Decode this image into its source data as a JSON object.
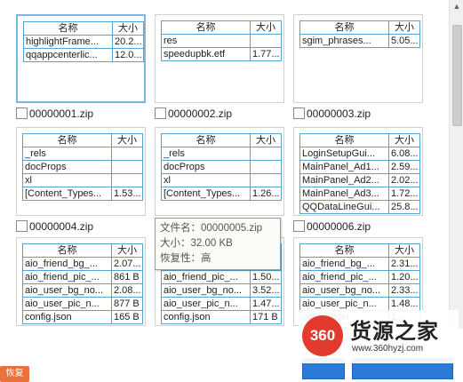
{
  "header": {
    "name": "名称",
    "size": "大小"
  },
  "items": [
    {
      "caption": "00000001.zip",
      "selected": true,
      "rows": [
        [
          "highlightFrame...",
          "20.2..."
        ],
        [
          "qqappcenterlic...",
          "12.0..."
        ]
      ]
    },
    {
      "caption": "00000002.zip",
      "selected": false,
      "rows": [
        [
          "res",
          ""
        ],
        [
          "speedupbk.etf",
          "1.77..."
        ]
      ]
    },
    {
      "caption": "00000003.zip",
      "selected": false,
      "rows": [
        [
          "sgim_phrases...",
          "5.05..."
        ]
      ]
    },
    {
      "caption": "00000004.zip",
      "selected": false,
      "rows": [
        [
          "_rels",
          ""
        ],
        [
          "docProps",
          ""
        ],
        [
          "xl",
          ""
        ],
        [
          "[Content_Types...",
          "1.53..."
        ]
      ]
    },
    {
      "caption": "00000005.zip",
      "selected": false,
      "rows": [
        [
          "_rels",
          ""
        ],
        [
          "docProps",
          ""
        ],
        [
          "xl",
          ""
        ],
        [
          "[Content_Types...",
          "1.26..."
        ]
      ]
    },
    {
      "caption": "00000006.zip",
      "selected": false,
      "rows": [
        [
          "LoginSetupGui...",
          "6.08..."
        ],
        [
          "MainPanel_Ad1...",
          "2.59..."
        ],
        [
          "MainPanel_Ad2...",
          "2.02..."
        ],
        [
          "MainPanel_Ad3...",
          "1.72..."
        ],
        [
          "QQDataLineGui...",
          "25.8..."
        ]
      ]
    },
    {
      "caption": "",
      "selected": false,
      "rows": [
        [
          "aio_friend_bg_...",
          "2.07..."
        ],
        [
          "aio_friend_pic_...",
          "861 B"
        ],
        [
          "aio_user_bg_no...",
          "2.08..."
        ],
        [
          "aio_user_pic_n...",
          "877 B"
        ],
        [
          "config.json",
          "165 B"
        ]
      ]
    },
    {
      "caption": "",
      "selected": false,
      "rows": [
        [
          "aio_friend_bg_...",
          "2.0..."
        ],
        [
          "aio_friend_pic_...",
          "1.50..."
        ],
        [
          "aio_user_bg_no...",
          "3.52..."
        ],
        [
          "aio_user_pic_n...",
          "1.47..."
        ],
        [
          "config.json",
          "171 B"
        ]
      ]
    },
    {
      "caption": "",
      "selected": false,
      "rows": [
        [
          "aio_friend_bg_...",
          "2.31..."
        ],
        [
          "aio_friend_pic_...",
          "1.20..."
        ],
        [
          "aio_user_bg_no...",
          "2.33..."
        ],
        [
          "aio_user_pic_n...",
          "1.48..."
        ],
        [
          "config.json",
          "1..."
        ]
      ]
    }
  ],
  "tooltip": {
    "filename": "文件名：00000005.zip",
    "size": "大小：32.00 KB",
    "recover": "恢复性：高"
  },
  "badge": "恢复",
  "watermark": {
    "logo": "360",
    "name": "货源之家",
    "url": "www.360hyzj.com"
  }
}
